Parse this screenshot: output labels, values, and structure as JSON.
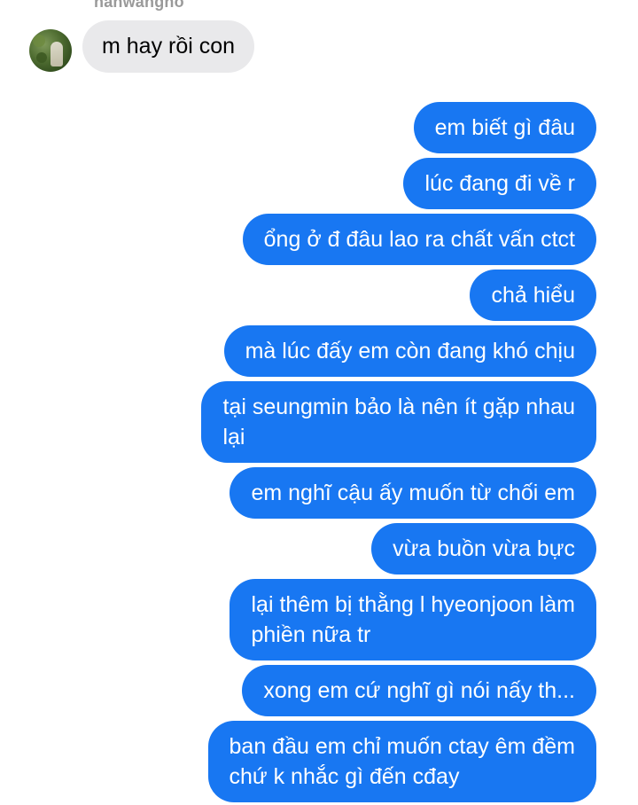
{
  "conversation": {
    "sender_name": "hanwangho",
    "incoming": [
      {
        "text": "m hay rồi con"
      }
    ],
    "outgoing": [
      {
        "text": "em biết gì đâu"
      },
      {
        "text": "lúc đang đi về r"
      },
      {
        "text": "ổng ở đ đâu lao ra chất vấn ctct"
      },
      {
        "text": "chả hiểu"
      },
      {
        "text": "mà lúc đấy em còn đang khó chịu"
      },
      {
        "line1": "tại seungmin bảo là nên ít gặp nhau",
        "line2": "lại"
      },
      {
        "text": "em nghĩ cậu ấy muốn từ chối em"
      },
      {
        "text": "vừa buồn vừa bực"
      },
      {
        "line1": "lại thêm bị thằng l hyeonjoon làm",
        "line2": "phiền nữa tr"
      },
      {
        "text": "xong em cứ nghĩ gì nói nấy th..."
      },
      {
        "line1": "ban đầu em chỉ muốn ctay êm đềm",
        "line2": "chứ k nhắc gì đến cđay"
      }
    ]
  },
  "colors": {
    "outgoing_bubble": "#1877f2",
    "incoming_bubble": "#e9e9eb",
    "sender_name": "#9a9a9a"
  },
  "icons": {
    "avatar": "profile-photo"
  }
}
